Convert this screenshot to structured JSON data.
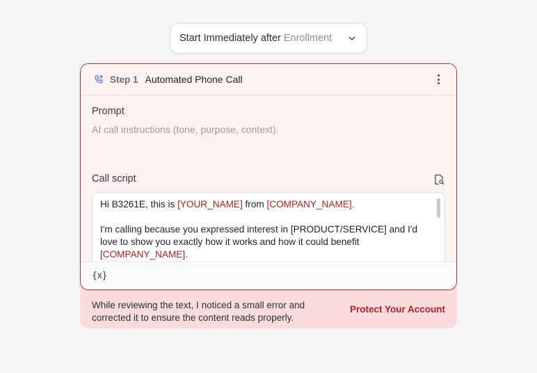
{
  "trigger": {
    "main": "Start Immediately after",
    "sub": "Enrollment",
    "icon": "chevron-down-icon"
  },
  "step": {
    "label": "Step 1",
    "title": "Automated Phone Call",
    "icon": "phone-icon"
  },
  "prompt": {
    "label": "Prompt",
    "placeholder": "AI call instructions (tone, purpose, context)."
  },
  "call_script": {
    "label": "Call script",
    "line1_a": "Hi B3261E, this is ",
    "line1_var1": "[YOUR_NAME]",
    "line1_b": " from ",
    "line1_var2": "[COMPANY_NAME].",
    "para2_a": "I'm calling because you expressed interest in [PRODUCT/SERVICE] and I'd love to show you exactly how it works and how it could benefit ",
    "para2_var": "[COMPANY_NAME]."
  },
  "footer": {
    "variable_button": "{x}"
  },
  "notice": {
    "text": "While reviewing the text, I noticed a small error and corrected it to ensure the content reads properly.",
    "action": "Protect Your Account"
  },
  "colors": {
    "accent_red": "#c62b2b",
    "variable_red": "#b32020",
    "notice_bg": "#fbdcdc",
    "card_tint": "#fdf2f2"
  }
}
